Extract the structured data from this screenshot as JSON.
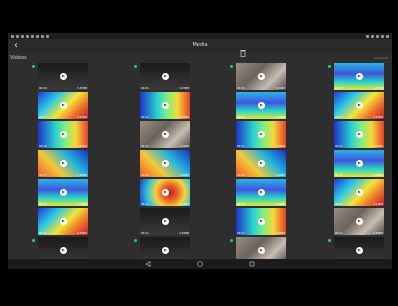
{
  "status_bar": {
    "left_icons": 8,
    "right_icons": 5
  },
  "app_bar": {
    "title": "Media",
    "back_icon": "arrow-left-icon",
    "delete_icon": "trash-icon"
  },
  "section": {
    "title": "Videos",
    "action": "Select all"
  },
  "accent_color": "#2fcf5a",
  "columns": [
    {
      "items": [
        {
          "style": "dark",
          "time": "00:26",
          "size": "5.25MB"
        },
        {
          "style": "thermal1",
          "time": "00:12",
          "size": "2.29MB"
        },
        {
          "style": "thermal2",
          "time": "00:18",
          "size": "3.87MB"
        },
        {
          "style": "thermal4",
          "time": "00:12",
          "size": "2.38MB"
        },
        {
          "style": "thermal3",
          "time": "00:12",
          "size": "2.24MB"
        },
        {
          "style": "thermal1",
          "time": "00:12",
          "size": "2.56MB"
        },
        {
          "style": "dark",
          "time": "00:12",
          "size": "2.06MB"
        }
      ]
    },
    {
      "items": [
        {
          "style": "dark",
          "time": "00:26",
          "size": "5.25MB"
        },
        {
          "style": "thermal2",
          "time": "00:12",
          "size": "2.29MB"
        },
        {
          "style": "photo",
          "time": "00:12",
          "size": "2.29MB"
        },
        {
          "style": "thermal4",
          "time": "00:12",
          "size": "2.38MB"
        },
        {
          "style": "thermal5",
          "time": "00:12",
          "size": "2.24MB"
        },
        {
          "style": "dark",
          "time": "00:12",
          "size": "2.56MB"
        },
        {
          "style": "dark",
          "time": "00:12",
          "size": "2.06MB"
        }
      ]
    },
    {
      "items": [
        {
          "style": "photo",
          "time": "00:26",
          "size": "5.25MB"
        },
        {
          "style": "thermal3",
          "time": "00:12",
          "size": "2.29MB"
        },
        {
          "style": "thermal2",
          "time": "00:12",
          "size": "2.29MB"
        },
        {
          "style": "thermal4",
          "time": "00:12",
          "size": "2.38MB"
        },
        {
          "style": "thermal3",
          "time": "00:12",
          "size": "2.24MB"
        },
        {
          "style": "thermal2",
          "time": "00:12",
          "size": "2.56MB"
        },
        {
          "style": "photo",
          "time": "00:12",
          "size": "2.06MB"
        }
      ]
    },
    {
      "items": [
        {
          "style": "thermal3",
          "time": "00:26",
          "size": "5.25MB"
        },
        {
          "style": "thermal1",
          "time": "00:12",
          "size": "2.29MB"
        },
        {
          "style": "thermal2",
          "time": "00:12",
          "size": "2.29MB"
        },
        {
          "style": "thermal3",
          "time": "00:12",
          "size": "2.38MB"
        },
        {
          "style": "thermal1",
          "time": "00:12",
          "size": "2.24MB"
        },
        {
          "style": "photo",
          "time": "00:12",
          "size": "2.56MB"
        },
        {
          "style": "dark",
          "time": "00:12",
          "size": "2.06MB"
        }
      ]
    }
  ],
  "nav_bar": {
    "back_icon": "triangle-back-icon",
    "home_icon": "circle-home-icon",
    "recents_icon": "square-recents-icon"
  }
}
